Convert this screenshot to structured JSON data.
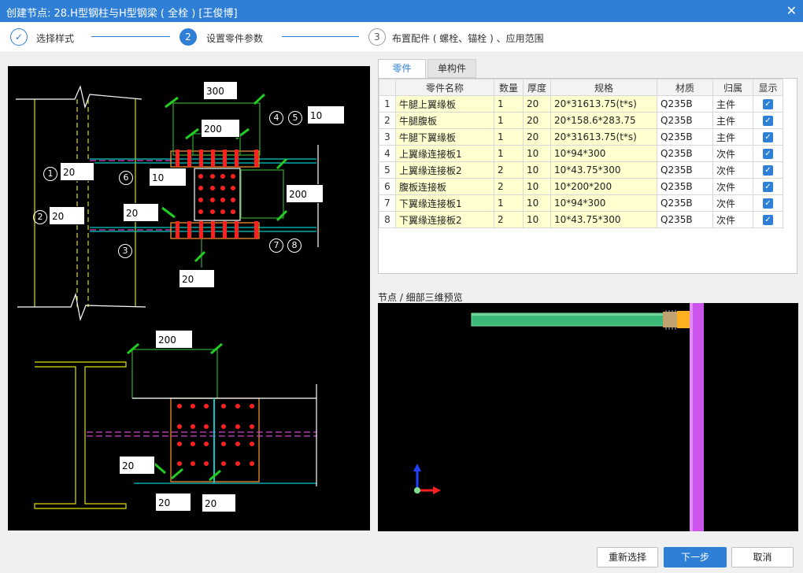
{
  "window": {
    "title": "创建节点: 28.H型钢柱与H型钢梁 ( 全栓 ) [王俊博]",
    "close_glyph": "✕"
  },
  "steps": [
    {
      "number": "✓",
      "label": "选择样式"
    },
    {
      "number": "2",
      "label": "设置零件参数"
    },
    {
      "number": "3",
      "label": "布置配件 ( 螺栓、锚栓 ) 、应用范围"
    }
  ],
  "drawing": {
    "dims": {
      "d300": "300",
      "d200a": "200",
      "d10a": "10",
      "d200r": "200",
      "d10b": "10",
      "d20a": "20",
      "d20b": "20",
      "d20c": "20",
      "d20d": "20",
      "d200b": "200",
      "d20e": "20",
      "d20f": "20",
      "d20g": "20"
    },
    "markers": {
      "m1": "1",
      "m2": "2",
      "m3": "3",
      "m4": "4",
      "m5": "5",
      "m6": "6",
      "m7": "7",
      "m8": "8"
    }
  },
  "tabs": {
    "parts": "零件",
    "single": "单构件"
  },
  "table": {
    "headers": [
      "",
      "零件名称",
      "数量",
      "厚度",
      "规格",
      "材质",
      "归属",
      "显示"
    ],
    "rows": [
      {
        "index": "1",
        "name": "牛腿上翼缘板",
        "qty": "1",
        "thk": "20",
        "spec": "20*31613.75(t*s)",
        "mat": "Q235B",
        "owner": "主件"
      },
      {
        "index": "2",
        "name": "牛腿腹板",
        "qty": "1",
        "thk": "20",
        "spec": "20*158.6*283.75",
        "mat": "Q235B",
        "owner": "主件"
      },
      {
        "index": "3",
        "name": "牛腿下翼缘板",
        "qty": "1",
        "thk": "20",
        "spec": "20*31613.75(t*s)",
        "mat": "Q235B",
        "owner": "主件"
      },
      {
        "index": "4",
        "name": "上翼缘连接板1",
        "qty": "1",
        "thk": "10",
        "spec": "10*94*300",
        "mat": "Q235B",
        "owner": "次件"
      },
      {
        "index": "5",
        "name": "上翼缘连接板2",
        "qty": "2",
        "thk": "10",
        "spec": "10*43.75*300",
        "mat": "Q235B",
        "owner": "次件"
      },
      {
        "index": "6",
        "name": "腹板连接板",
        "qty": "2",
        "thk": "10",
        "spec": "10*200*200",
        "mat": "Q235B",
        "owner": "次件"
      },
      {
        "index": "7",
        "name": "下翼缘连接板1",
        "qty": "1",
        "thk": "10",
        "spec": "10*94*300",
        "mat": "Q235B",
        "owner": "次件"
      },
      {
        "index": "8",
        "name": "下翼缘连接板2",
        "qty": "2",
        "thk": "10",
        "spec": "10*43.75*300",
        "mat": "Q235B",
        "owner": "次件"
      }
    ],
    "check_glyph": "✓"
  },
  "preview": {
    "title": "节点 / 细部三维预览"
  },
  "buttons": {
    "reselect": "重新选择",
    "next": "下一步",
    "cancel": "取消"
  },
  "colors": {
    "accent": "#2f7fd6",
    "cell_highlight": "#ffffd0",
    "beam_green": "#3cb878",
    "column_magenta": "#cc55ee"
  }
}
